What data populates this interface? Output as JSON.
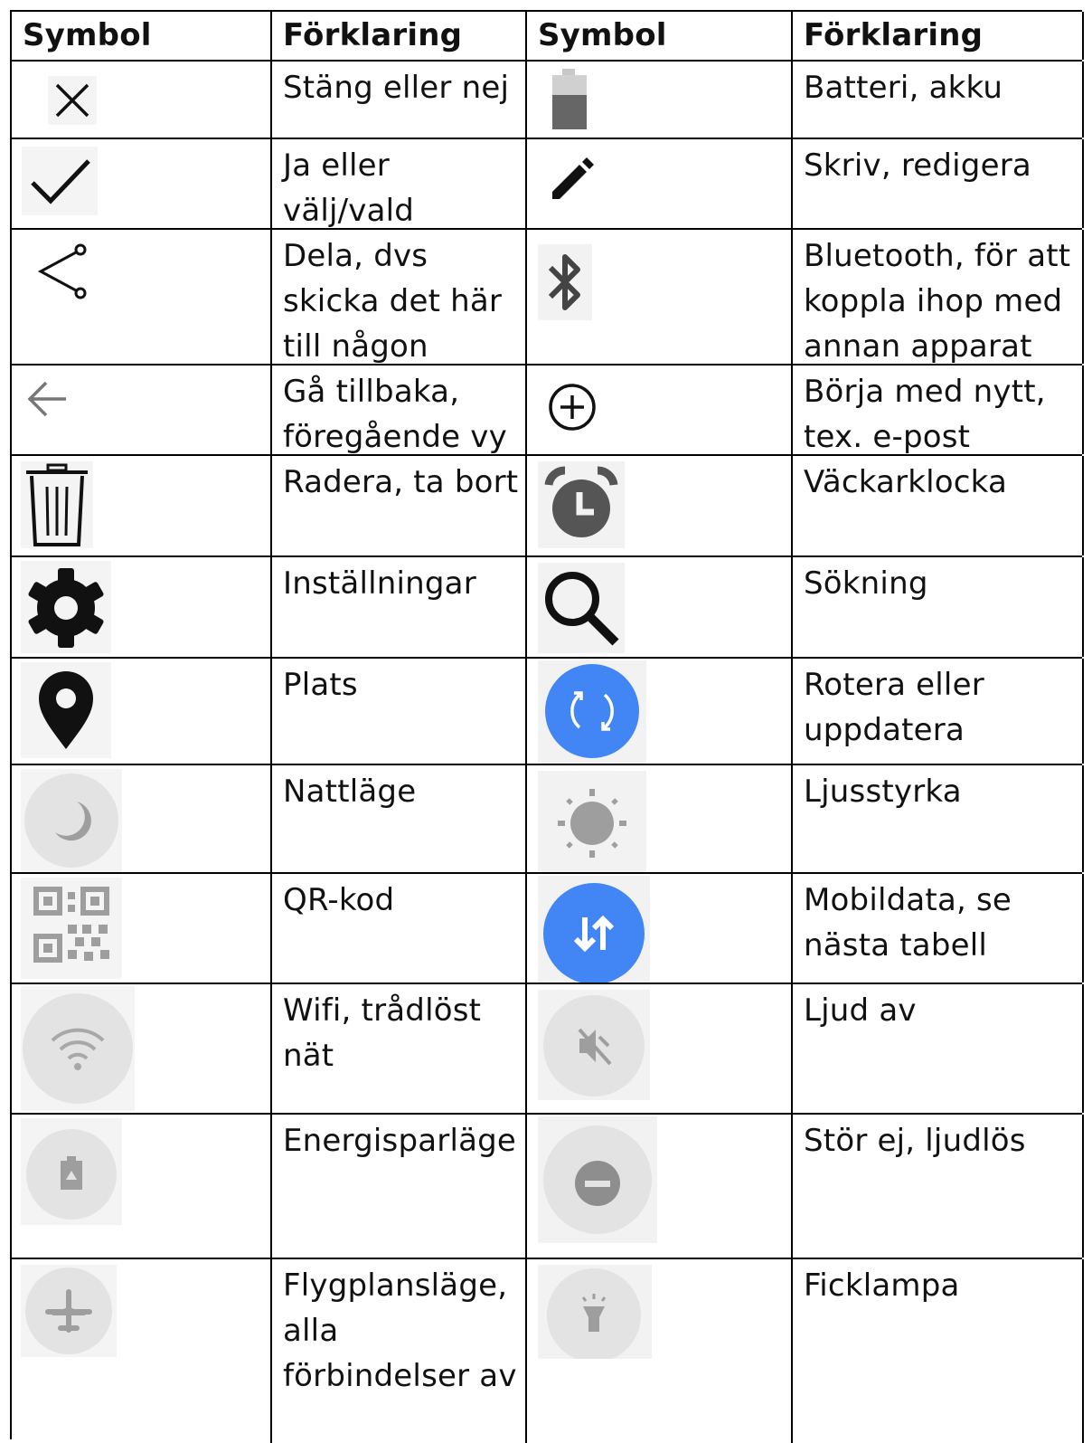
{
  "header": {
    "col1": "Symbol",
    "col2": "Förklaring",
    "col3": "Symbol",
    "col4": "Förklaring"
  },
  "rows": [
    {
      "left_icon": "close-icon",
      "left_text": "Stäng eller nej",
      "right_icon": "battery-icon",
      "right_text": "Batteri, akku"
    },
    {
      "left_icon": "checkmark-icon",
      "left_text": "Ja eller välj/vald",
      "right_icon": "pencil-icon",
      "right_text": "Skriv, redigera"
    },
    {
      "left_icon": "share-icon",
      "left_text": "Dela, dvs skicka det här till någon",
      "right_icon": "bluetooth-icon",
      "right_text": "Bluetooth, för att koppla ihop med annan apparat"
    },
    {
      "left_icon": "arrow-back-icon",
      "left_text": "Gå tillbaka, föregående vy",
      "right_icon": "add-circle-icon",
      "right_text": "Börja med nytt, tex. e-post"
    },
    {
      "left_icon": "trash-icon",
      "left_text": "Radera, ta bort",
      "right_icon": "alarm-clock-icon",
      "right_text": "Väckarklocka"
    },
    {
      "left_icon": "gear-icon",
      "left_text": "Inställningar",
      "right_icon": "search-icon",
      "right_text": "Sökning"
    },
    {
      "left_icon": "location-pin-icon",
      "left_text": "Plats",
      "right_icon": "rotate-icon",
      "right_text": "Rotera eller uppdatera"
    },
    {
      "left_icon": "moon-icon",
      "left_text": "Nattläge",
      "right_icon": "brightness-icon",
      "right_text": "Ljusstyrka"
    },
    {
      "left_icon": "qr-code-icon",
      "left_text": "QR-kod",
      "right_icon": "mobile-data-icon",
      "right_text": "Mobildata, se nästa tabell"
    },
    {
      "left_icon": "wifi-icon",
      "left_text": "Wifi, trådlöst nät",
      "right_icon": "sound-off-icon",
      "right_text": "Ljud av"
    },
    {
      "left_icon": "battery-saver-icon",
      "left_text": "Energisparläge",
      "right_icon": "do-not-disturb-icon",
      "right_text": "Stör ej, ljudlös"
    },
    {
      "left_icon": "airplane-icon",
      "left_text": "Flygplansläge, alla förbindelser av",
      "right_icon": "flashlight-icon",
      "right_text": "Ficklampa"
    }
  ],
  "colors": {
    "border": "#000000",
    "accent_blue": "#4285f4",
    "tile_gray": "#e5e5e5",
    "icon_gray": "#9e9e9e"
  }
}
